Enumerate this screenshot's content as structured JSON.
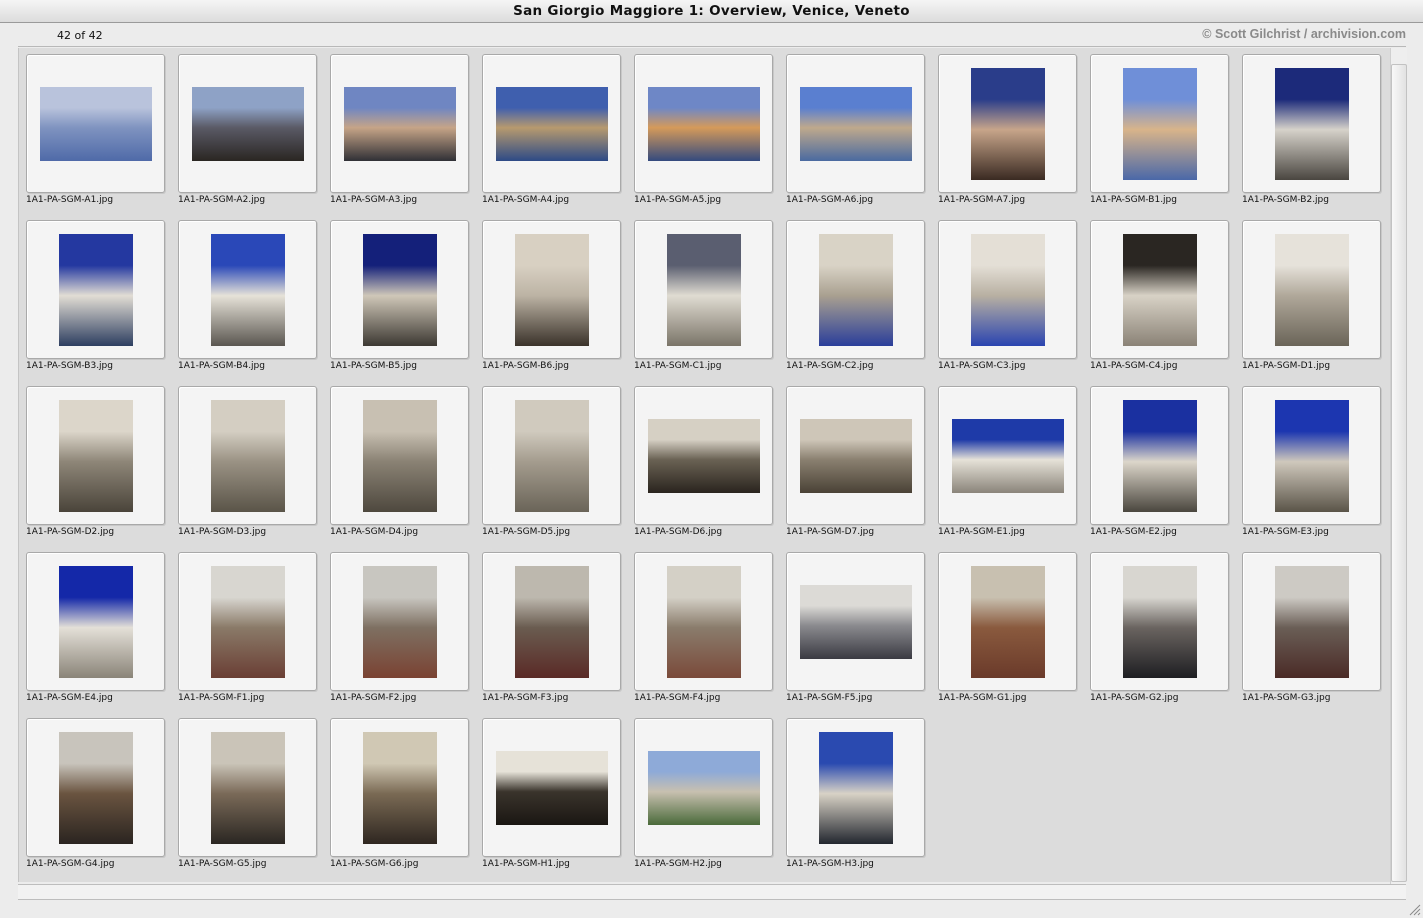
{
  "window": {
    "title": "San Giorgio Maggiore 1: Overview, Venice, Veneto"
  },
  "header": {
    "count": "42 of 42",
    "copyright": "© Scott Gilchrist / archivision.com"
  },
  "thumbnails": [
    {
      "filename": "1A1-PA-SGM-A1.jpg",
      "orientation": "landscape",
      "palette": [
        "#b9c3dc",
        "#7f93c0",
        "#4f6aa8"
      ]
    },
    {
      "filename": "1A1-PA-SGM-A2.jpg",
      "orientation": "landscape",
      "palette": [
        "#8ea2c6",
        "#5a5a66",
        "#2a2622"
      ]
    },
    {
      "filename": "1A1-PA-SGM-A3.jpg",
      "orientation": "landscape",
      "palette": [
        "#6f86c2",
        "#c6a487",
        "#303036"
      ]
    },
    {
      "filename": "1A1-PA-SGM-A4.jpg",
      "orientation": "landscape",
      "palette": [
        "#3f5fae",
        "#b79a6e",
        "#2d4a86"
      ]
    },
    {
      "filename": "1A1-PA-SGM-A5.jpg",
      "orientation": "landscape",
      "palette": [
        "#6e87c6",
        "#d59a5a",
        "#344a7e"
      ]
    },
    {
      "filename": "1A1-PA-SGM-A6.jpg",
      "orientation": "landscape",
      "palette": [
        "#5a7fd0",
        "#bfa98c",
        "#4a6aa0"
      ]
    },
    {
      "filename": "1A1-PA-SGM-A7.jpg",
      "orientation": "portrait",
      "palette": [
        "#2a3d8a",
        "#c7a58a",
        "#3a2a22"
      ]
    },
    {
      "filename": "1A1-PA-SGM-B1.jpg",
      "orientation": "portrait",
      "palette": [
        "#6f8fd8",
        "#d8b48a",
        "#4a68a8"
      ]
    },
    {
      "filename": "1A1-PA-SGM-B2.jpg",
      "orientation": "portrait",
      "palette": [
        "#1c2a7a",
        "#d6d2ca",
        "#4a4640"
      ]
    },
    {
      "filename": "1A1-PA-SGM-B3.jpg",
      "orientation": "portrait",
      "palette": [
        "#2438a0",
        "#e2ddd4",
        "#2d3e60"
      ]
    },
    {
      "filename": "1A1-PA-SGM-B4.jpg",
      "orientation": "portrait",
      "palette": [
        "#2a48b8",
        "#e6e2d8",
        "#5a5650"
      ]
    },
    {
      "filename": "1A1-PA-SGM-B5.jpg",
      "orientation": "portrait",
      "palette": [
        "#14207a",
        "#cfc7b8",
        "#3c3832"
      ]
    },
    {
      "filename": "1A1-PA-SGM-B6.jpg",
      "orientation": "portrait",
      "palette": [
        "#d8d0c2",
        "#bcb3a4",
        "#3a322a"
      ]
    },
    {
      "filename": "1A1-PA-SGM-C1.jpg",
      "orientation": "portrait",
      "palette": [
        "#5a5e70",
        "#e0dcd2",
        "#7a7468"
      ]
    },
    {
      "filename": "1A1-PA-SGM-C2.jpg",
      "orientation": "portrait",
      "palette": [
        "#d9d3c6",
        "#a9a090",
        "#2a3e9a"
      ]
    },
    {
      "filename": "1A1-PA-SGM-C3.jpg",
      "orientation": "portrait",
      "palette": [
        "#e4dfd6",
        "#b8b0a2",
        "#2a44b0"
      ]
    },
    {
      "filename": "1A1-PA-SGM-C4.jpg",
      "orientation": "portrait",
      "palette": [
        "#2a2622",
        "#d8d2c6",
        "#8a8276"
      ]
    },
    {
      "filename": "1A1-PA-SGM-D1.jpg",
      "orientation": "portrait",
      "palette": [
        "#e6e2da",
        "#b0a89a",
        "#6a6458"
      ]
    },
    {
      "filename": "1A1-PA-SGM-D2.jpg",
      "orientation": "portrait",
      "palette": [
        "#dcd6ca",
        "#8e8678",
        "#4a443a"
      ]
    },
    {
      "filename": "1A1-PA-SGM-D3.jpg",
      "orientation": "portrait",
      "palette": [
        "#d4cec2",
        "#9a9284",
        "#5a5448"
      ]
    },
    {
      "filename": "1A1-PA-SGM-D4.jpg",
      "orientation": "portrait",
      "palette": [
        "#c8c0b2",
        "#8a8274",
        "#4e483e"
      ]
    },
    {
      "filename": "1A1-PA-SGM-D5.jpg",
      "orientation": "portrait",
      "palette": [
        "#d0cabe",
        "#a49c8e",
        "#6a6458"
      ]
    },
    {
      "filename": "1A1-PA-SGM-D6.jpg",
      "orientation": "landscape",
      "palette": [
        "#d6d0c4",
        "#6a6254",
        "#2a241e"
      ]
    },
    {
      "filename": "1A1-PA-SGM-D7.jpg",
      "orientation": "landscape",
      "palette": [
        "#cec6b8",
        "#8a8070",
        "#4a4236"
      ]
    },
    {
      "filename": "1A1-PA-SGM-E1.jpg",
      "orientation": "landscape",
      "palette": [
        "#1e3aa8",
        "#e6e2d8",
        "#8a847a"
      ]
    },
    {
      "filename": "1A1-PA-SGM-E2.jpg",
      "orientation": "portrait",
      "palette": [
        "#1a30a0",
        "#dcd6ca",
        "#4a463e"
      ]
    },
    {
      "filename": "1A1-PA-SGM-E3.jpg",
      "orientation": "portrait",
      "palette": [
        "#1c36b0",
        "#cfc8bc",
        "#5a5448"
      ]
    },
    {
      "filename": "1A1-PA-SGM-E4.jpg",
      "orientation": "portrait",
      "palette": [
        "#1428a8",
        "#e4e0d8",
        "#8a8478"
      ]
    },
    {
      "filename": "1A1-PA-SGM-F1.jpg",
      "orientation": "portrait",
      "palette": [
        "#d8d6d0",
        "#8a7a68",
        "#6a3e34"
      ]
    },
    {
      "filename": "1A1-PA-SGM-F2.jpg",
      "orientation": "portrait",
      "palette": [
        "#c8c6c0",
        "#7e7062",
        "#7a4232"
      ]
    },
    {
      "filename": "1A1-PA-SGM-F3.jpg",
      "orientation": "portrait",
      "palette": [
        "#bdb8ae",
        "#6a5c50",
        "#5a2a26"
      ]
    },
    {
      "filename": "1A1-PA-SGM-F4.jpg",
      "orientation": "portrait",
      "palette": [
        "#d4d0c6",
        "#8a7c6c",
        "#7a4a3a"
      ]
    },
    {
      "filename": "1A1-PA-SGM-F5.jpg",
      "orientation": "landscape",
      "palette": [
        "#dcdad6",
        "#8a8a8e",
        "#3a3a42"
      ]
    },
    {
      "filename": "1A1-PA-SGM-G1.jpg",
      "orientation": "portrait",
      "palette": [
        "#c8c0b0",
        "#8a5a3e",
        "#6a3a2a"
      ]
    },
    {
      "filename": "1A1-PA-SGM-G2.jpg",
      "orientation": "portrait",
      "palette": [
        "#d8d6d0",
        "#6a6460",
        "#1e1e22"
      ]
    },
    {
      "filename": "1A1-PA-SGM-G3.jpg",
      "orientation": "portrait",
      "palette": [
        "#cdcac4",
        "#6a5e56",
        "#4a2a26"
      ]
    },
    {
      "filename": "1A1-PA-SGM-G4.jpg",
      "orientation": "portrait",
      "palette": [
        "#c8c4bc",
        "#6a5440",
        "#2a2420"
      ]
    },
    {
      "filename": "1A1-PA-SGM-G5.jpg",
      "orientation": "portrait",
      "palette": [
        "#cac4b8",
        "#7a6a58",
        "#2a2622"
      ]
    },
    {
      "filename": "1A1-PA-SGM-G6.jpg",
      "orientation": "portrait",
      "palette": [
        "#d0c8b4",
        "#7a6a54",
        "#2e2620"
      ]
    },
    {
      "filename": "1A1-PA-SGM-H1.jpg",
      "orientation": "landscape",
      "palette": [
        "#e6e2d8",
        "#3a342c",
        "#1a1612"
      ]
    },
    {
      "filename": "1A1-PA-SGM-H2.jpg",
      "orientation": "landscape",
      "palette": [
        "#8eaad8",
        "#c8c0b0",
        "#4a6a3a"
      ]
    },
    {
      "filename": "1A1-PA-SGM-H3.jpg",
      "orientation": "portrait",
      "palette": [
        "#2a4ab0",
        "#d8d2c6",
        "#22262e"
      ]
    }
  ]
}
